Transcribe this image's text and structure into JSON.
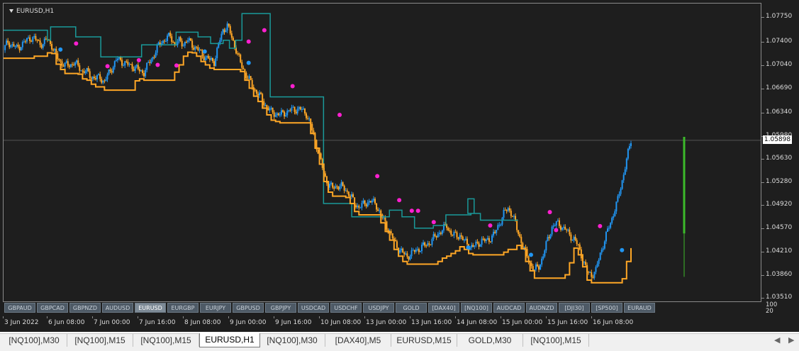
{
  "chart_title": "EURUSD,H1",
  "current_price": "1.05898",
  "price_axis": [
    "1.07750",
    "1.07400",
    "1.07040",
    "1.06690",
    "1.06340",
    "1.05980",
    "1.05630",
    "1.05280",
    "1.04920",
    "1.04570",
    "1.04210",
    "1.03860",
    "1.03510"
  ],
  "sub_axis": [
    "100",
    "20"
  ],
  "time_axis": [
    "3 Jun 2022",
    "6 Jun 08:00",
    "7 Jun 00:00",
    "7 Jun 16:00",
    "8 Jun 08:00",
    "9 Jun 00:00",
    "9 Jun 16:00",
    "10 Jun 08:00",
    "13 Jun 00:00",
    "13 Jun 16:00",
    "14 Jun 08:00",
    "15 Jun 00:00",
    "15 Jun 16:00",
    "16 Jun 08:00"
  ],
  "symbol_buttons": [
    "GBPAUD",
    "GBPCAD",
    "GBPNZD",
    "AUDUSD",
    "EURUSD",
    "EURGBP",
    "EURJPY",
    "GBPUSD",
    "GBPJPY",
    "USDCAD",
    "USDCHF",
    "USDJPY",
    "GOLD",
    "[DAX40]",
    "[NQ100]",
    "AUDCAD",
    "AUDNZD",
    "[DJI30]",
    "[SP500]",
    "EURAUD"
  ],
  "active_symbol": "EURUSD",
  "tabs": [
    "[NQ100],M30",
    "[NQ100],M15",
    "[NQ100],M15",
    "EURUSD,H1",
    "[NQ100],M30",
    "[DAX40],M5",
    "EURUSD,M15",
    "GOLD,M30",
    "[NQ100],M15"
  ],
  "active_tab": "EURUSD,H1",
  "colors": {
    "background": "#1e1e1e",
    "bull_candle": "#2196f3",
    "bear_candle": "#ffa726",
    "upper_band": "#1a9a9a",
    "lower_band": "#ffa726",
    "signal_up": "#2196f3",
    "signal_down": "#ff1fd0",
    "volume_bar": "#3cba2a"
  },
  "chart_data": {
    "type": "candlestick",
    "symbol": "EURUSD",
    "timeframe": "H1",
    "ylim": [
      1.0346,
      1.0795
    ],
    "close_path": [
      1.0725,
      1.0738,
      1.0732,
      1.0728,
      1.0733,
      1.0738,
      1.0744,
      1.0742,
      1.0737,
      1.0734,
      1.0742,
      1.0732,
      1.0716,
      1.0708,
      1.0702,
      1.0703,
      1.0706,
      1.0701,
      1.0694,
      1.0692,
      1.0686,
      1.0682,
      1.0685,
      1.0677,
      1.0691,
      1.0702,
      1.0712,
      1.0708,
      1.0704,
      1.0702,
      1.0699,
      1.0694,
      1.0692,
      1.0704,
      1.0715,
      1.0728,
      1.0738,
      1.0742,
      1.0746,
      1.0734,
      1.0738,
      1.0735,
      1.074,
      1.0733,
      1.0728,
      1.072,
      1.0715,
      1.071,
      1.0708,
      1.0733,
      1.0755,
      1.0762,
      1.0744,
      1.0726,
      1.0705,
      1.0692,
      1.068,
      1.0668,
      1.066,
      1.065,
      1.064,
      1.0632,
      1.063,
      1.0628,
      1.0631,
      1.0634,
      1.0636,
      1.0637,
      1.0635,
      1.063,
      1.0612,
      1.059,
      1.0566,
      1.054,
      1.0524,
      1.0518,
      1.0522,
      1.052,
      1.0516,
      1.0507,
      1.0495,
      1.049,
      1.0493,
      1.0498,
      1.0498,
      1.0492,
      1.0478,
      1.0465,
      1.0452,
      1.0438,
      1.0428,
      1.042,
      1.0416,
      1.042,
      1.0425,
      1.0428,
      1.0432,
      1.0436,
      1.0442,
      1.045,
      1.0455,
      1.0462,
      1.045,
      1.0446,
      1.0448,
      1.0438,
      1.0432,
      1.043,
      1.0434,
      1.044,
      1.0438,
      1.0444,
      1.045,
      1.0465,
      1.048,
      1.0487,
      1.0479,
      1.0456,
      1.0439,
      1.042,
      1.0406,
      1.0395,
      1.04,
      1.0418,
      1.044,
      1.046,
      1.0465,
      1.0462,
      1.0456,
      1.0448,
      1.0442,
      1.043,
      1.0412,
      1.0392,
      1.0388,
      1.0394,
      1.042,
      1.044,
      1.046,
      1.048,
      1.05,
      1.053,
      1.056,
      1.059
    ],
    "upper_band": [
      [
        0,
        1.0755
      ],
      [
        0.07,
        1.0755
      ],
      [
        0.07,
        1.074
      ],
      [
        0.075,
        1.074
      ],
      [
        0.075,
        1.076
      ],
      [
        0.115,
        1.076
      ],
      [
        0.115,
        1.0745
      ],
      [
        0.155,
        1.0745
      ],
      [
        0.155,
        1.0715
      ],
      [
        0.22,
        1.0715
      ],
      [
        0.22,
        1.0733
      ],
      [
        0.275,
        1.0733
      ],
      [
        0.275,
        1.0752
      ],
      [
        0.31,
        1.0752
      ],
      [
        0.31,
        1.0745
      ],
      [
        0.33,
        1.0745
      ],
      [
        0.33,
        1.0735
      ],
      [
        0.35,
        1.0735
      ],
      [
        0.35,
        1.074
      ],
      [
        0.36,
        1.074
      ],
      [
        0.36,
        1.0728
      ],
      [
        0.37,
        1.0728
      ],
      [
        0.37,
        1.074
      ],
      [
        0.38,
        1.074
      ],
      [
        0.38,
        1.078
      ],
      [
        0.42,
        1.078
      ],
      [
        0.42,
        1.078
      ],
      [
        0.425,
        1.078
      ],
      [
        0.425,
        1.0655
      ],
      [
        0.51,
        1.0655
      ],
      [
        0.51,
        1.0495
      ],
      [
        0.555,
        1.0495
      ],
      [
        0.555,
        1.0475
      ],
      [
        0.615,
        1.0475
      ],
      [
        0.615,
        1.0485
      ],
      [
        0.635,
        1.0485
      ],
      [
        0.635,
        1.0475
      ],
      [
        0.655,
        1.0475
      ],
      [
        0.655,
        1.0458
      ],
      [
        0.685,
        1.0458
      ],
      [
        0.685,
        1.0462
      ],
      [
        0.705,
        1.0462
      ],
      [
        0.705,
        1.0478
      ],
      [
        0.745,
        1.0478
      ],
      [
        0.745,
        1.048
      ],
      [
        0.75,
        1.048
      ],
      [
        0.75,
        1.0502
      ],
      [
        0.74,
        1.0502
      ],
      [
        0.74,
        1.048
      ],
      [
        0.76,
        1.048
      ],
      [
        0.76,
        1.047
      ],
      [
        0.815,
        1.047
      ],
      [
        0.815,
        1.047
      ],
      [
        0.82,
        1.047
      ]
    ],
    "lower_band_segments": "step line below price",
    "signals_down": 18,
    "signals_up": 6
  }
}
